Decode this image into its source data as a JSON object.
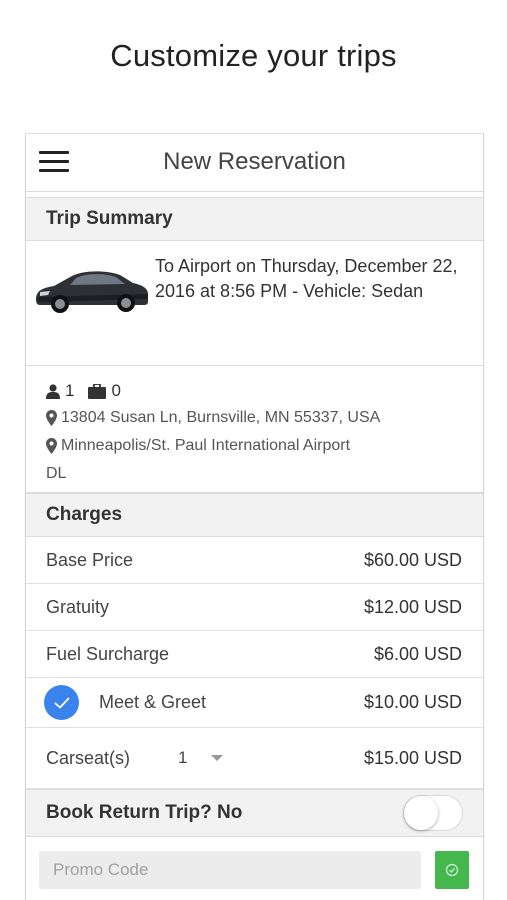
{
  "headline": "Customize your trips",
  "navbar": {
    "title": "New Reservation",
    "menu_icon": "hamburger-menu-icon"
  },
  "trip_summary": {
    "header": "Trip Summary",
    "description": "To Airport on Thursday, December 22, 2016 at 8:56 PM - Vehicle: Sedan",
    "passengers": "1",
    "luggage": "0",
    "pickup": "13804 Susan Ln, Burnsville, MN 55337, USA",
    "dropoff": "Minneapolis/St. Paul International Airport",
    "airline": "DL"
  },
  "charges": {
    "header": "Charges",
    "base_price": {
      "label": "Base Price",
      "amount": "$60.00 USD"
    },
    "gratuity": {
      "label": "Gratuity",
      "amount": "$12.00 USD"
    },
    "fuel": {
      "label": "Fuel Surcharge",
      "amount": "$6.00 USD"
    },
    "meet_greet": {
      "label": "Meet & Greet",
      "amount": "$10.00 USD",
      "checked": true
    },
    "carseat": {
      "label": "Carseat(s)",
      "quantity": "1",
      "amount": "$15.00 USD"
    }
  },
  "return_trip": {
    "label": "Book Return Trip? No",
    "enabled": false
  },
  "promo": {
    "placeholder": "Promo Code",
    "button_icon": "check-circle-icon"
  },
  "colors": {
    "accent_blue": "#3a83ec",
    "apply_green": "#44b84c",
    "section_bg": "#f2f2f2"
  }
}
